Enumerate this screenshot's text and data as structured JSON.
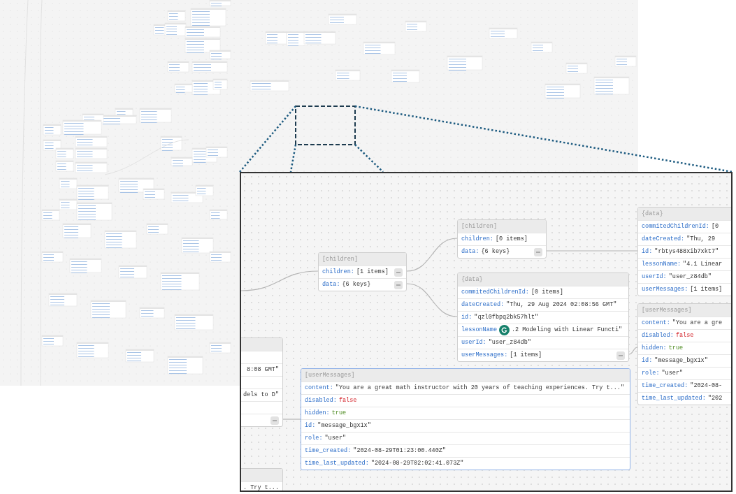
{
  "inset": {
    "nodes": [
      {
        "title": "[children]",
        "selected": false,
        "rows": [
          {
            "key": "children:",
            "value": "[1 items]",
            "kind": "text",
            "collapsible": true
          },
          {
            "key": "data:",
            "value": "{6 keys}",
            "kind": "text",
            "collapsible": true
          }
        ]
      },
      {
        "title": "[children]",
        "selected": false,
        "rows": [
          {
            "key": "children:",
            "value": "[0 items]",
            "kind": "text",
            "collapsible": false
          },
          {
            "key": "data:",
            "value": "{6 keys}",
            "kind": "text",
            "collapsible": true
          }
        ]
      },
      {
        "title": "{data}",
        "selected": false,
        "rows": [
          {
            "key": "commitedChildrenId:",
            "value": "[0 items]",
            "kind": "text",
            "collapsible": false,
            "badge": false
          },
          {
            "key": "dateCreated:",
            "value": "\"Thu, 29 Aug 2024 02:08:56 GMT\"",
            "kind": "text",
            "collapsible": false,
            "badge": false
          },
          {
            "key": "id:",
            "value": "\"qzl0fbpq2bk57hlt\"",
            "kind": "text",
            "collapsible": false,
            "badge": false
          },
          {
            "key": "lessonName",
            "value": ".2 Modeling with Linear Functi\"",
            "kind": "text",
            "collapsible": false,
            "badge": true
          },
          {
            "key": "userId:",
            "value": "\"user_z84db\"",
            "kind": "text",
            "collapsible": false,
            "badge": false
          },
          {
            "key": "userMessages:",
            "value": "[1 items]",
            "kind": "text",
            "collapsible": true,
            "badge": false
          }
        ]
      },
      {
        "title": "{data}",
        "selected": false,
        "rows": [
          {
            "key": "commitedChildrenId:",
            "value": "[0",
            "kind": "text",
            "collapsible": false
          },
          {
            "key": "dateCreated:",
            "value": "\"Thu, 29",
            "kind": "text",
            "collapsible": false
          },
          {
            "key": "id:",
            "value": "\"rbtys488xib7xkt7\"",
            "kind": "text",
            "collapsible": false
          },
          {
            "key": "lessonName:",
            "value": "\"4.1 Linear",
            "kind": "text",
            "collapsible": false
          },
          {
            "key": "userId:",
            "value": "\"user_z84db\"",
            "kind": "text",
            "collapsible": false
          },
          {
            "key": "userMessages:",
            "value": "[1 items]",
            "kind": "text",
            "collapsible": false
          }
        ]
      },
      {
        "title": "[userMessages]",
        "selected": false,
        "rows": [
          {
            "key": "content:",
            "value": "\"You are a gre",
            "kind": "text",
            "collapsible": false
          },
          {
            "key": "disabled:",
            "value": "false",
            "kind": "negative",
            "collapsible": false
          },
          {
            "key": "hidden:",
            "value": "true",
            "kind": "positive",
            "collapsible": false
          },
          {
            "key": "id:",
            "value": "\"message_bgx1x\"",
            "kind": "text",
            "collapsible": false
          },
          {
            "key": "role:",
            "value": "\"user\"",
            "kind": "text",
            "collapsible": false
          },
          {
            "key": "time_created:",
            "value": "\"2024-08-",
            "kind": "text",
            "collapsible": false
          },
          {
            "key": "time_last_updated:",
            "value": "\"202",
            "kind": "text",
            "collapsible": false
          }
        ]
      },
      {
        "title": "[userMessages]",
        "selected": true,
        "rows": [
          {
            "key": "content:",
            "value": "\"You are a great math instructor with 20 years of teaching experiences. Try t...\"",
            "kind": "text",
            "collapsible": false
          },
          {
            "key": "disabled:",
            "value": "false",
            "kind": "negative",
            "collapsible": false
          },
          {
            "key": "hidden:",
            "value": "true",
            "kind": "positive",
            "collapsible": false
          },
          {
            "key": "id:",
            "value": "\"message_bgx1x\"",
            "kind": "text",
            "collapsible": false
          },
          {
            "key": "role:",
            "value": "\"user\"",
            "kind": "text",
            "collapsible": false
          },
          {
            "key": "time_created:",
            "value": "\"2024-08-29T01:23:00.440Z\"",
            "kind": "text",
            "collapsible": false
          },
          {
            "key": "time_last_updated:",
            "value": "\"2024-08-29T02:02:41.073Z\"",
            "kind": "text",
            "collapsible": false
          }
        ]
      },
      {
        "selected": false,
        "rows": [
          {
            "collapsible": false
          },
          {
            "value": "8:08 GMT\"",
            "kind": "text",
            "collapsible": false
          },
          {
            "collapsible": false
          },
          {
            "value": "dels to D\"",
            "kind": "text",
            "collapsible": false
          },
          {
            "collapsible": false
          },
          {
            "collapsible": true
          }
        ]
      },
      {
        "selected": false,
        "rows": [
          {
            "value": ". Try t...",
            "kind": "text",
            "collapsible": false
          }
        ]
      }
    ]
  }
}
